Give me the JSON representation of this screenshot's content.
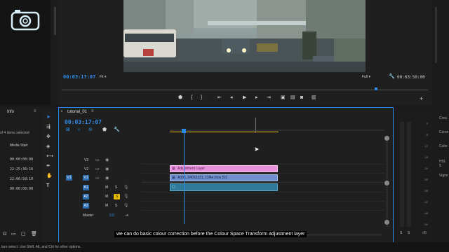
{
  "program_monitor": {
    "timecode_left": "00:03:17:07",
    "fit_label": "Fit",
    "quality_label": "Full",
    "timecode_right": "00:03:50:00"
  },
  "left_panel": {
    "tab_info": "Info",
    "selection_text": "of 4 items selected",
    "column_header": "Media Start",
    "timecodes": [
      "00:00:00:00",
      "22:25:36:16",
      "22:06:58:10",
      "00:00:00:00"
    ]
  },
  "timeline": {
    "sequence_tab": "tutorial_01",
    "timecode": "00:03:17:07",
    "video_tracks": [
      "V3",
      "V2",
      "V1"
    ],
    "source_patch": "V1",
    "audio_tracks": [
      "A1",
      "A2",
      "A3"
    ],
    "mute_label": "M",
    "solo_label": "S",
    "master_label": "Master",
    "master_value": "0.0",
    "clips": {
      "adjustment_layer": "Adjustment Layer",
      "video_clip": "A005_04032221_C04e.mov [V]"
    }
  },
  "right_panel": {
    "labels": [
      "Crea",
      "Curve",
      "Color",
      "HSL S",
      "Vigne"
    ]
  },
  "vu_meter": {
    "scale": [
      "0",
      "-6",
      "-12",
      "-18",
      "-24",
      "-30",
      "-36",
      "-42",
      "-48",
      "-54"
    ],
    "solo_labels": [
      "S",
      "S"
    ],
    "db_label": "dB"
  },
  "status_bar": "ture select. Use Shift, Alt, and Ctrl for other options.",
  "subtitle": "we can do basic colour correction before the Colour Space Transform adjustment layer",
  "colors": {
    "accent": "#2d8ceb",
    "adjustment_clip": "#e691d9",
    "video_clip": "#6f8fcf",
    "audio_clip": "#2f7a9a",
    "work_area": "#e6c019"
  }
}
